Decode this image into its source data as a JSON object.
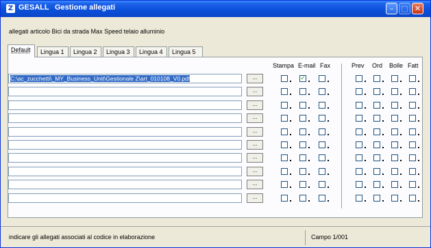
{
  "window": {
    "app_code": "GESALL",
    "title": "Gestione allegati",
    "app_icon": "Z",
    "minimize_icon": "minimize-icon",
    "maximize_icon": "maximize-icon",
    "close_icon": "close-icon"
  },
  "article_label": "allegati articolo Bici da strada Max Speed telaio alluminio",
  "tabs": [
    {
      "label": "Default",
      "active": true
    },
    {
      "label": "Lingua 1",
      "active": false
    },
    {
      "label": "Lingua 2",
      "active": false
    },
    {
      "label": "Lingua 3",
      "active": false
    },
    {
      "label": "Lingua 4",
      "active": false
    },
    {
      "label": "Lingua 5",
      "active": false
    }
  ],
  "headers": {
    "stampa": "Stampa",
    "email": "E-mail",
    "fax": "Fax",
    "prev": "Prev",
    "ord": "Ord",
    "bolle": "Bolle",
    "fatt": "Fatt"
  },
  "browse_label": "...",
  "rows": [
    {
      "path": "C:\\ac_zucchetti\\_MY_Business_Unit\\Gestionale Z\\art_010108_V0.pdf",
      "selected": true,
      "stampa": false,
      "email": true,
      "fax": false,
      "prev": false,
      "ord": false,
      "bolle": false,
      "fatt": false
    },
    {
      "path": "",
      "selected": false,
      "stampa": false,
      "email": false,
      "fax": false,
      "prev": false,
      "ord": false,
      "bolle": false,
      "fatt": false
    },
    {
      "path": "",
      "selected": false,
      "stampa": false,
      "email": false,
      "fax": false,
      "prev": false,
      "ord": false,
      "bolle": false,
      "fatt": false
    },
    {
      "path": "",
      "selected": false,
      "stampa": false,
      "email": false,
      "fax": false,
      "prev": false,
      "ord": false,
      "bolle": false,
      "fatt": false
    },
    {
      "path": "",
      "selected": false,
      "stampa": false,
      "email": false,
      "fax": false,
      "prev": false,
      "ord": false,
      "bolle": false,
      "fatt": false
    },
    {
      "path": "",
      "selected": false,
      "stampa": false,
      "email": false,
      "fax": false,
      "prev": false,
      "ord": false,
      "bolle": false,
      "fatt": false
    },
    {
      "path": "",
      "selected": false,
      "stampa": false,
      "email": false,
      "fax": false,
      "prev": false,
      "ord": false,
      "bolle": false,
      "fatt": false
    },
    {
      "path": "",
      "selected": false,
      "stampa": false,
      "email": false,
      "fax": false,
      "prev": false,
      "ord": false,
      "bolle": false,
      "fatt": false
    },
    {
      "path": "",
      "selected": false,
      "stampa": false,
      "email": false,
      "fax": false,
      "prev": false,
      "ord": false,
      "bolle": false,
      "fatt": false
    },
    {
      "path": "",
      "selected": false,
      "stampa": false,
      "email": false,
      "fax": false,
      "prev": false,
      "ord": false,
      "bolle": false,
      "fatt": false
    }
  ],
  "status": {
    "message": "indicare gli allegati associati al codice in elaborazione",
    "campo": "Campo 1/001"
  }
}
